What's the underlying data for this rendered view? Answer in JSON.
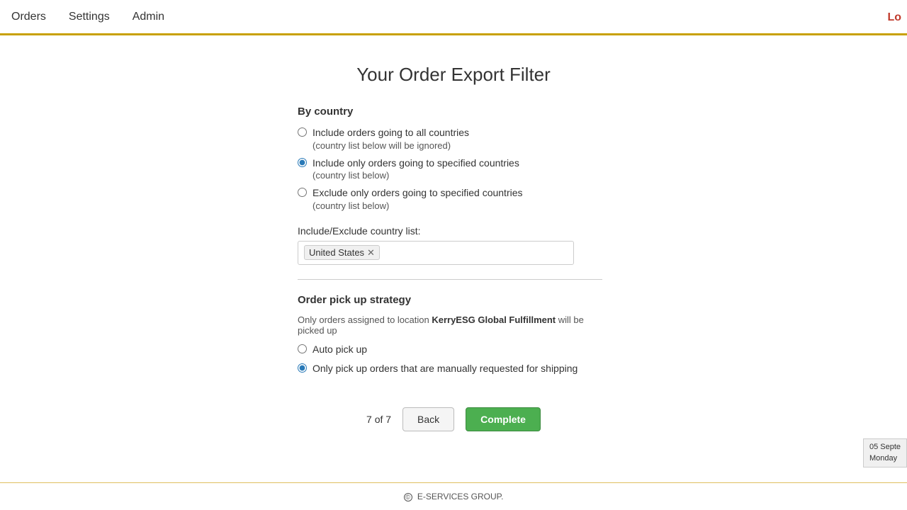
{
  "header": {
    "nav_items": [
      "Orders",
      "Settings",
      "Admin"
    ],
    "right_text": "Lo"
  },
  "page": {
    "title": "Your Order Export Filter",
    "by_country_section": {
      "label": "By country",
      "options": [
        {
          "id": "all_countries",
          "label": "Include orders going to all countries",
          "sublabel": "(country list below will be ignored)",
          "selected": false
        },
        {
          "id": "include_specified",
          "label": "Include only orders going to specified countries",
          "sublabel": "(country list below)",
          "selected": true
        },
        {
          "id": "exclude_specified",
          "label": "Exclude only orders going to specified countries",
          "sublabel": "(country list below)",
          "selected": false
        }
      ],
      "country_list_label": "Include/Exclude country list:",
      "country_tags": [
        "United States"
      ]
    },
    "pickup_section": {
      "label": "Order pick up strategy",
      "description_prefix": "Only orders assigned to location ",
      "description_bold": "KerryESG Global Fulfillment",
      "description_suffix": " will be picked up",
      "options": [
        {
          "id": "auto_pickup",
          "label": "Auto pick up",
          "selected": false
        },
        {
          "id": "manual_pickup",
          "label": "Only pick up orders that are manually requested for shipping",
          "selected": true
        }
      ]
    },
    "pagination": {
      "current": 7,
      "total": 7,
      "text": "7 of 7"
    },
    "buttons": {
      "back": "Back",
      "complete": "Complete"
    }
  },
  "footer": {
    "text": "E-SERVICES GROUP."
  },
  "date_badge": {
    "line1": "05 Septe",
    "line2": "Monday"
  }
}
